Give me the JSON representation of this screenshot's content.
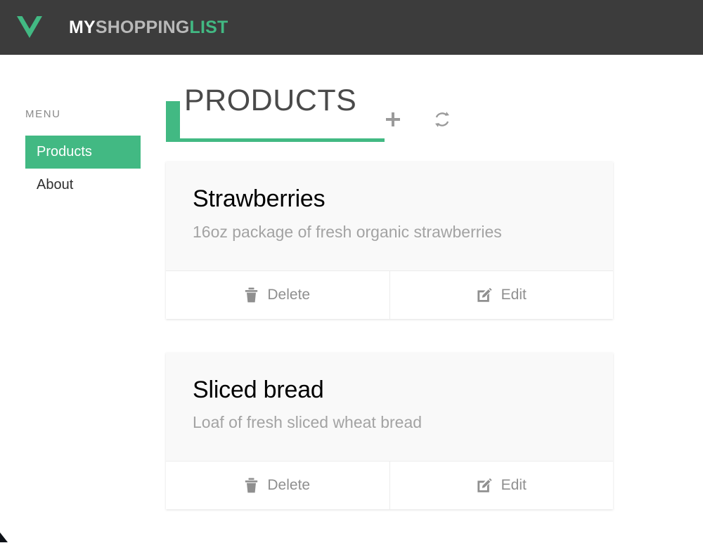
{
  "header": {
    "logo_icon": "vue-logo-icon",
    "brand_part1": "MY",
    "brand_part2": "SHOPPING",
    "brand_part3": "LIST",
    "background_color": "#3c3c3c",
    "accent_color": "#42b983"
  },
  "sidebar": {
    "label": "MENU",
    "items": [
      {
        "label": "Products",
        "active": true
      },
      {
        "label": "About",
        "active": false
      }
    ]
  },
  "main": {
    "title": "PRODUCTS",
    "accent_color": "#42b983",
    "actions": [
      {
        "name": "add-product-button",
        "icon": "plus-icon"
      },
      {
        "name": "refresh-button",
        "icon": "refresh-icon"
      }
    ],
    "cards": [
      {
        "title": "Strawberries",
        "description": "16oz package of fresh organic strawberries",
        "delete_label": "Delete",
        "edit_label": "Edit",
        "delete_icon": "trash-icon",
        "edit_icon": "edit-icon"
      },
      {
        "title": "Sliced bread",
        "description": "Loaf of fresh sliced wheat bread",
        "delete_label": "Delete",
        "edit_label": "Edit",
        "delete_icon": "trash-icon",
        "edit_icon": "edit-icon"
      }
    ]
  }
}
